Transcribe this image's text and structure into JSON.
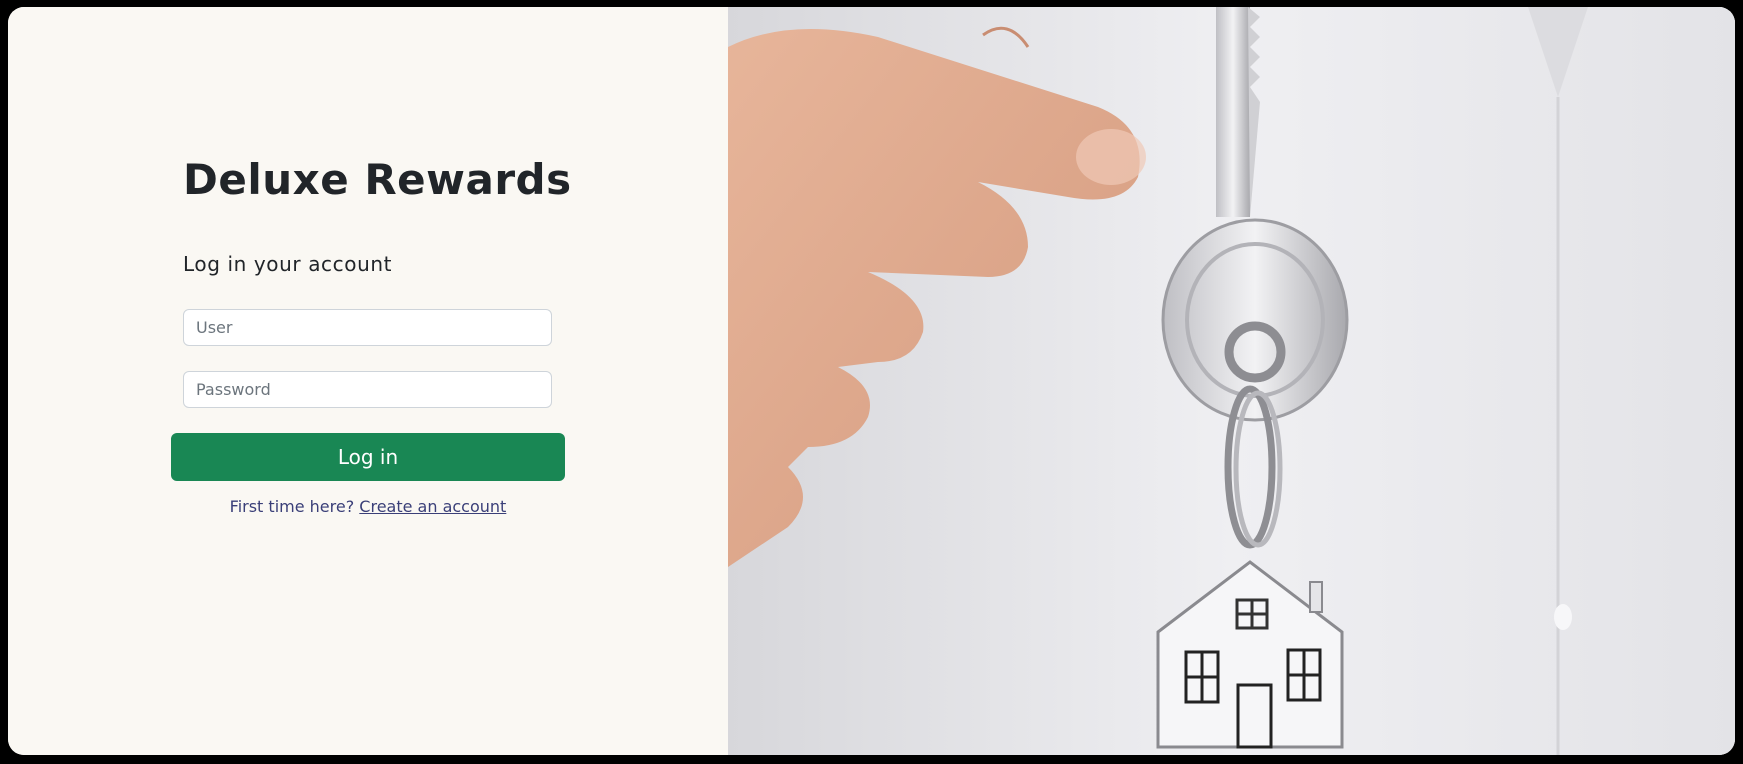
{
  "login": {
    "brand_title": "Deluxe Rewards",
    "subtitle": "Log in your account",
    "user_placeholder": "User",
    "password_placeholder": "Password",
    "login_button_label": "Log in",
    "signup_prompt": "First time here?",
    "signup_link_label": "Create an account"
  },
  "hero_image": {
    "subject": "hand holding a key with a house-shaped keychain"
  },
  "colors": {
    "background": "#faf8f3",
    "primary_button": "#198754",
    "link": "#3a3f78",
    "heading": "#212529"
  }
}
